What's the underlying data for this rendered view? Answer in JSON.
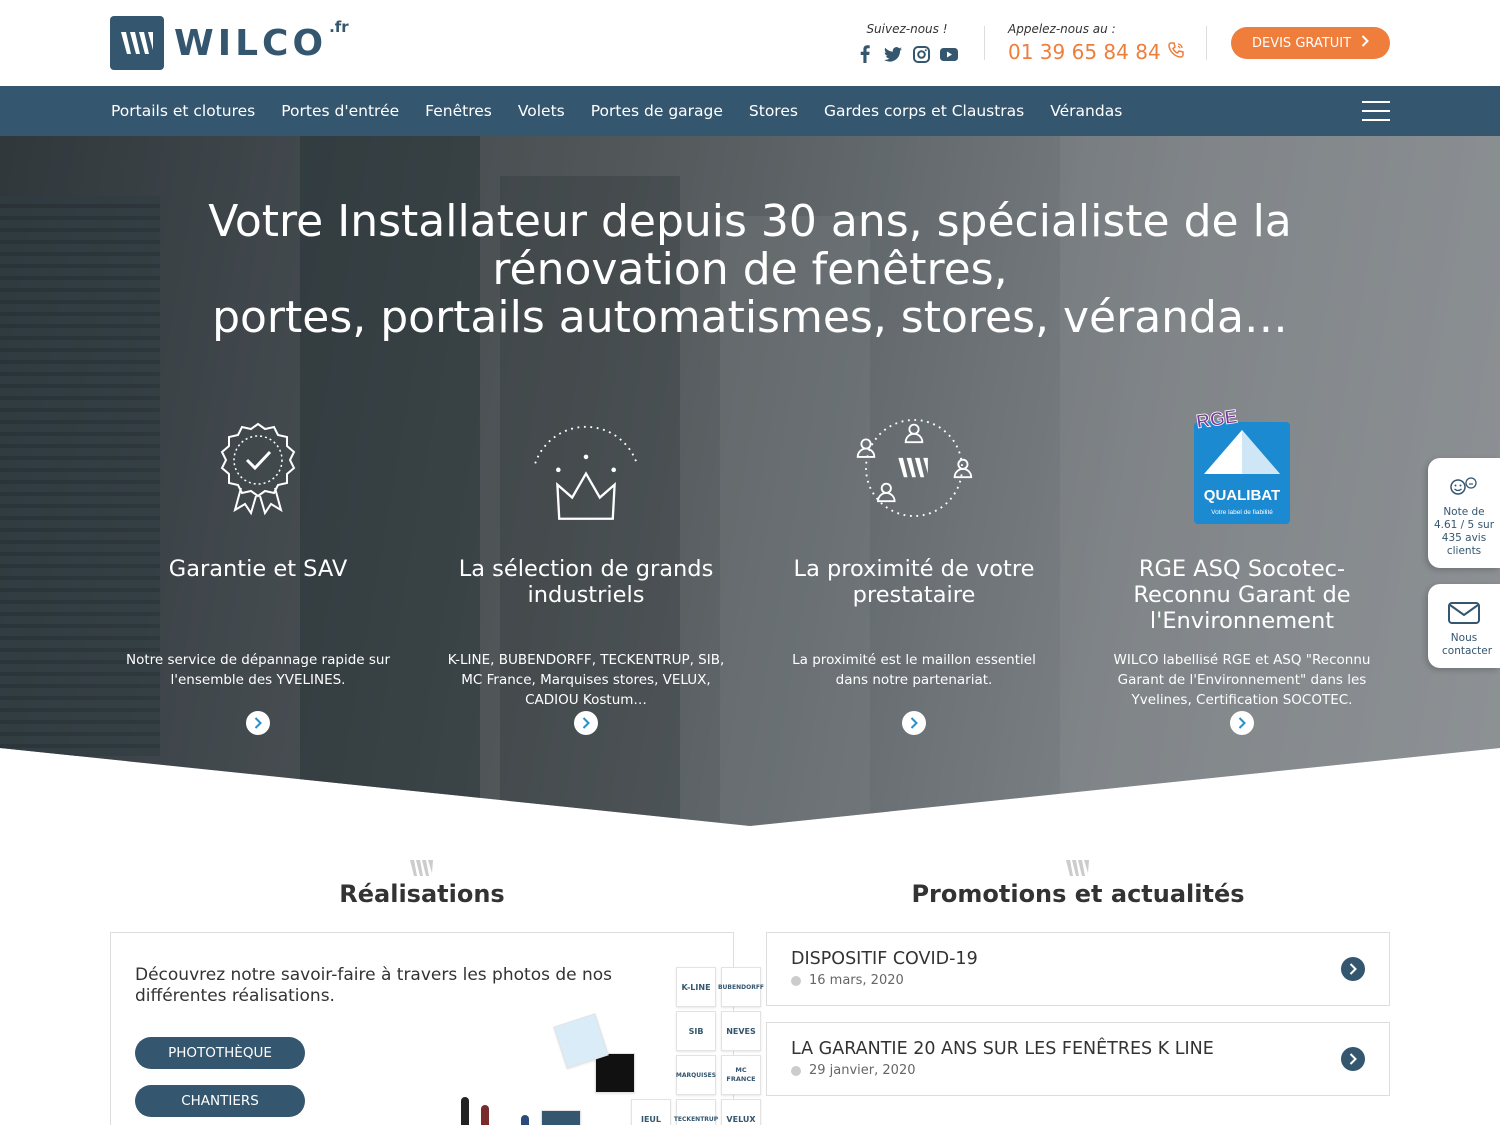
{
  "header": {
    "logo_text": "WILCO",
    "logo_tld": ".fr",
    "follow_label": "Suivez-nous !",
    "socials": [
      "facebook-icon",
      "twitter-icon",
      "instagram-icon",
      "youtube-icon"
    ],
    "call_label": "Appelez-nous au :",
    "phone": "01 39 65 84 84",
    "devis_label": "DEVIS GRATUIT"
  },
  "nav": {
    "items": [
      "Portails et clotures",
      "Portes d'entrée",
      "Fenêtres",
      "Volets",
      "Portes de garage",
      "Stores",
      "Gardes corps et Claustras",
      "Vérandas"
    ]
  },
  "hero": {
    "title_line1": "Votre Installateur depuis 30 ans, spécialiste de la rénovation de fenêtres,",
    "title_line2": "portes, portails automatismes, stores, véranda…"
  },
  "features": [
    {
      "title": "Garantie et SAV",
      "text": "Notre service de dépannage rapide sur l'ensemble des YVELINES.",
      "icon": "badge-check-icon"
    },
    {
      "title": "La sélection de grands industriels",
      "text": "K-LINE, BUBENDORFF, TECKENTRUP, SIB, MC France, Marquises stores, VELUX, CADIOU Kostum…",
      "icon": "crown-icon"
    },
    {
      "title": "La proximité de votre prestataire",
      "text": "La proximité est le maillon essentiel dans notre partenariat.",
      "icon": "people-circle-icon"
    },
    {
      "title": "RGE ASQ Socotec-Reconnu Garant de l'Environnement",
      "text": "WILCO labellisé RGE et ASQ \"Reconnu Garant de l'Environnement\" dans les Yvelines, Certification SOCOTEC.",
      "icon": "qualibat-rge-icon"
    }
  ],
  "qualibat": {
    "rge": "RGE",
    "name": "QUALIBAT",
    "tagline": "Votre label de fiabilité"
  },
  "side": {
    "rating": "Note de 4.61 / 5 sur 435 avis clients",
    "contact": "Nous contacter"
  },
  "realisations": {
    "title": "Réalisations",
    "text": "Découvrez notre savoir-faire à travers les photos de nos différentes réalisations.",
    "btn_photo": "PHOTOTHÈQUE",
    "btn_chantiers": "CHANTIERS",
    "brands": [
      "K-LINE",
      "BUBENDORFF",
      "SIB",
      "NEVES",
      "MARQUISES",
      "MC FRANCE",
      "TECKENTRUP",
      "VELUX",
      "IEUL"
    ]
  },
  "news": {
    "title": "Promotions et actualités",
    "items": [
      {
        "title": "DISPOSITIF COVID-19",
        "date": "16 mars, 2020"
      },
      {
        "title": "LA GARANTIE 20 ANS SUR LES FENÊTRES K LINE",
        "date": "29 janvier, 2020"
      }
    ]
  },
  "colors": {
    "brand": "#34566f",
    "accent": "#ef7d3c"
  }
}
